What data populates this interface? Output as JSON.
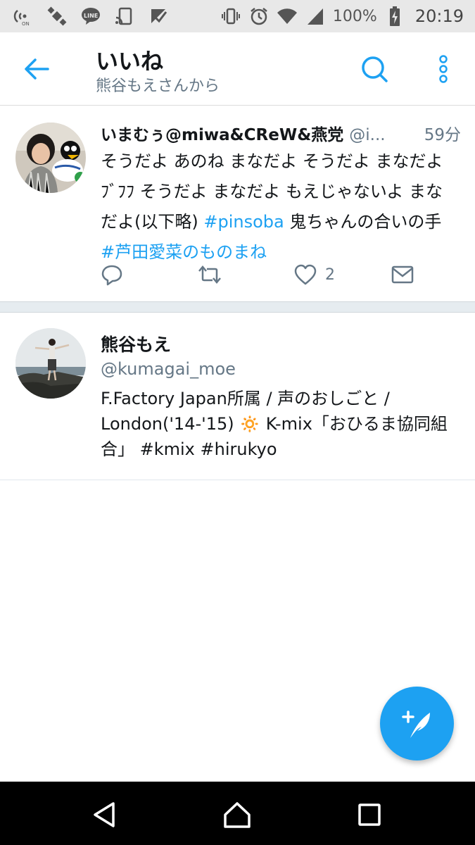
{
  "status_bar": {
    "battery": "100%",
    "time": "20:19",
    "icons_left": [
      "nfc-icon",
      "satellite-icon",
      "line-icon",
      "cast-icon",
      "check-icon"
    ],
    "icons_right": [
      "vibrate-icon",
      "alarm-icon",
      "wifi-icon",
      "signal-icon",
      "battery-icon"
    ]
  },
  "header": {
    "title": "いいね",
    "subtitle": "熊谷もえさんから"
  },
  "tweet": {
    "name": "いまむぅ@miwa&CReW&燕党",
    "handle": "@i...",
    "time": "59分",
    "body_text": "そうだよ あのね まなだよ そうだよ まなだよﾌﾞﾌﾌ そうだよ まなだよ もえじゃないよ まなだよ(以下略) ",
    "hashtag1": "#pinsoba",
    "body_mid": " 鬼ちゃんの合いの手 ",
    "hashtag2": "#芦田愛菜のものまね",
    "like_count": "2"
  },
  "user": {
    "name": "熊谷もえ",
    "handle": "@kumagai_moe",
    "bio": "F.Factory Japan所属 / 声のおしごと / London('14-'15) 🔅 K-mix「おひるま協同組合」 #kmix #hirukyo"
  },
  "colors": {
    "accent": "#1da1f2",
    "text": "#14171a",
    "secondary": "#657786"
  }
}
